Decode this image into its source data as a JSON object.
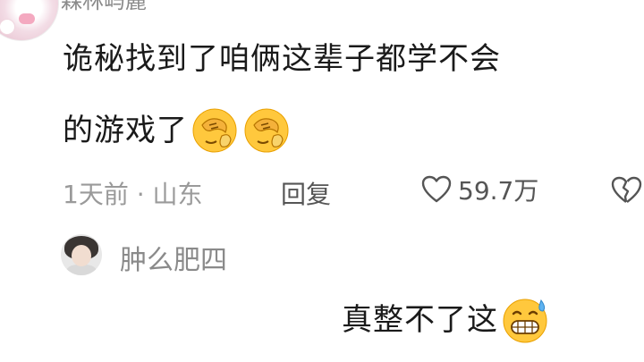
{
  "comment": {
    "username": "森林屿麓",
    "text_line1": "诡秘找到了咱俩这辈子都学不会",
    "text_line2": "的游戏了",
    "emojis": [
      "facepalm-emoji",
      "facepalm-emoji"
    ],
    "meta": "1天前 · 山东",
    "reply_label": "回复",
    "like_count": "59.7万"
  },
  "reply": {
    "username": "肿么肥四",
    "text": "真整不了这",
    "emoji": "grimacing-sweat-emoji"
  },
  "icons": {
    "like": "heart-outline-icon",
    "dislike": "broken-heart-icon"
  },
  "colors": {
    "text": "#1a1a1a",
    "meta": "#9a9a9a",
    "action": "#555555",
    "emoji_yellow": "#FFC83D"
  }
}
